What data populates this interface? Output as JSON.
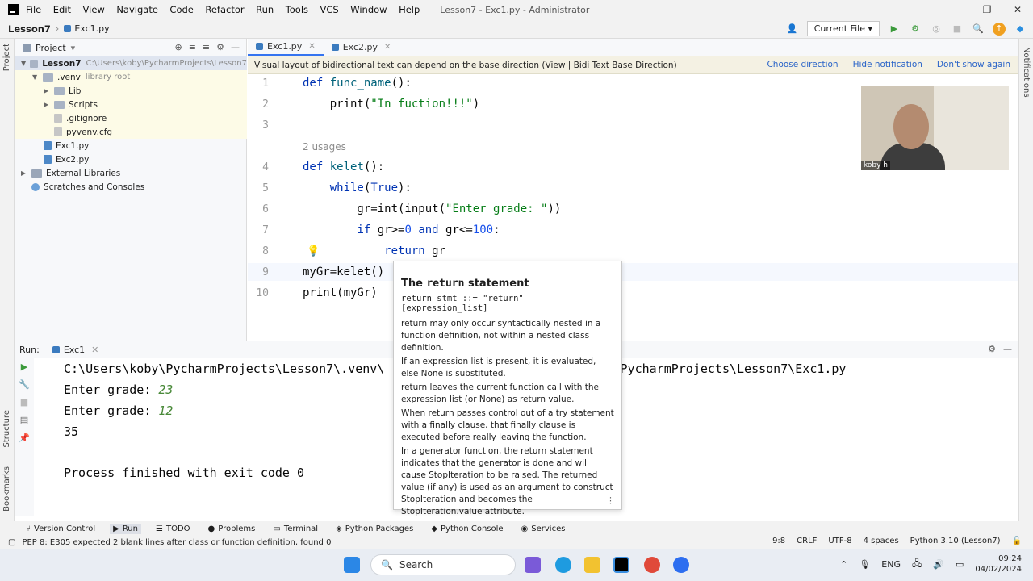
{
  "titlebar": {
    "menu": [
      "File",
      "Edit",
      "View",
      "Navigate",
      "Code",
      "Refactor",
      "Run",
      "Tools",
      "VCS",
      "Window",
      "Help"
    ],
    "window_title": "Lesson7 - Exc1.py - Administrator"
  },
  "navbar": {
    "project": "Lesson7",
    "file": "Exc1.py",
    "run_config": "Current File"
  },
  "left_strip": {
    "project_label": "Project",
    "structure_label": "Structure",
    "bookmarks_label": "Bookmarks"
  },
  "right_strip": {
    "notifications_label": "Notifications"
  },
  "project_panel": {
    "title": "Project",
    "items": [
      {
        "label": "Lesson7",
        "hint": "C:\\Users\\koby\\PycharmProjects\\Lesson7"
      },
      {
        "label": ".venv",
        "hint": "library root"
      },
      {
        "label": "Lib"
      },
      {
        "label": "Scripts"
      },
      {
        "label": ".gitignore"
      },
      {
        "label": "pyvenv.cfg"
      },
      {
        "label": "Exc1.py"
      },
      {
        "label": "Exc2.py"
      },
      {
        "label": "External Libraries"
      },
      {
        "label": "Scratches and Consoles"
      }
    ]
  },
  "tabs": [
    {
      "label": "Exc1.py",
      "active": true
    },
    {
      "label": "Exc2.py",
      "active": false
    }
  ],
  "notification": {
    "text": "Visual layout of bidirectional text can depend on the base direction (View | Bidi Text Base Direction)",
    "choose": "Choose direction",
    "hide": "Hide notification",
    "dont_show": "Don't show again"
  },
  "editor": {
    "usages": "2 usages",
    "line_numbers": [
      "1",
      "2",
      "3",
      "4",
      "5",
      "6",
      "7",
      "8",
      "9",
      "10"
    ]
  },
  "webcam": {
    "name": "koby h"
  },
  "run_panel": {
    "label": "Run:",
    "tab": "Exc1",
    "lines": {
      "path_a": "C:\\Users\\koby\\PycharmProjects\\Lesson7\\.venv\\",
      "path_b": "koby\\PycharmProjects\\Lesson7\\Exc1.py",
      "prompt1": "Enter grade: ",
      "input1": "23",
      "prompt2": "Enter grade: ",
      "input2": "12",
      "result": "35",
      "finished": "Process finished with exit code 0"
    }
  },
  "doc_popup": {
    "title_a": "The ",
    "title_b": "return",
    "title_c": " statement",
    "grammar": "return_stmt ::=  \"return\" [expression_list]",
    "p1": "return may only occur syntactically nested in a function definition, not within a nested class definition.",
    "p2": "If an expression list is present, it is evaluated, else None is substituted.",
    "p3": "return leaves the current function call with the expression list (or None) as return value.",
    "p4": "When return passes control out of a try statement with a finally clause, that finally clause is executed before really leaving the function.",
    "p5": "In a generator function, the return statement indicates that the generator is done and will cause StopIteration to be raised. The returned value (if any) is used as an argument to construct StopIteration and becomes the StopIteration.value attribute."
  },
  "bottom_tabs": [
    "Version Control",
    "Run",
    "TODO",
    "Problems",
    "Terminal",
    "Python Packages",
    "Python Console",
    "Services"
  ],
  "status": {
    "message": "PEP 8: E305 expected 2 blank lines after class or function definition, found 0",
    "position": "9:8",
    "line_sep": "CRLF",
    "encoding": "UTF-8",
    "indent": "4 spaces",
    "interpreter": "Python 3.10 (Lesson7)"
  },
  "taskbar": {
    "search": "Search",
    "lang": "ENG",
    "time": "09:24",
    "date": "04/02/2024"
  }
}
